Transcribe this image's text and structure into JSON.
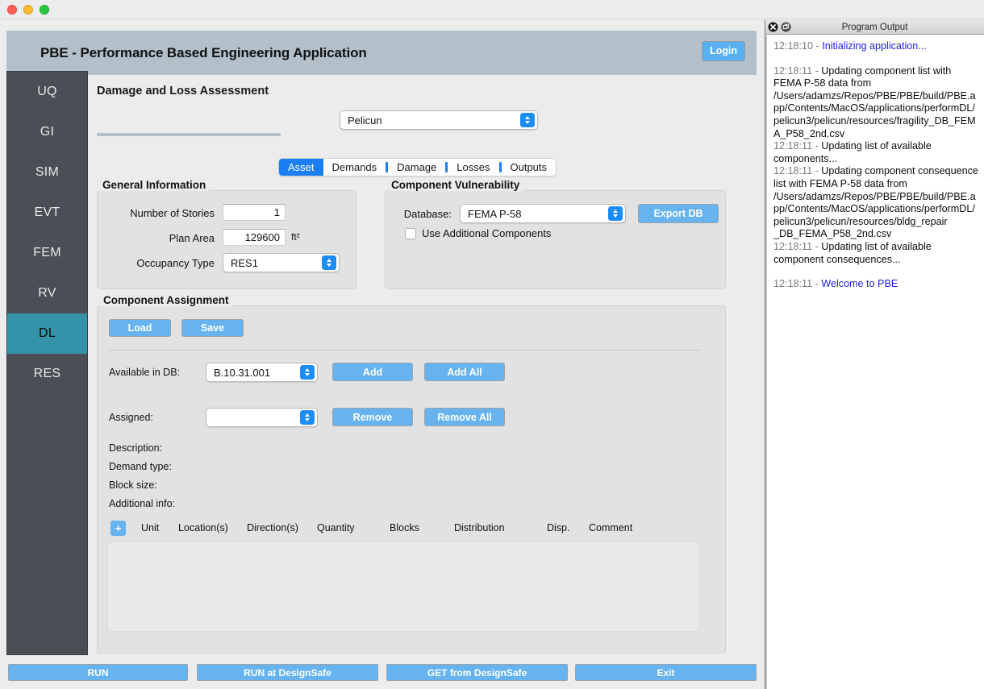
{
  "window": {
    "controls": [
      "close",
      "minimize",
      "maximize"
    ]
  },
  "header": {
    "title": "PBE - Performance Based Engineering Application",
    "login_label": "Login"
  },
  "sidebar": {
    "items": [
      {
        "label": "UQ",
        "active": false
      },
      {
        "label": "GI",
        "active": false
      },
      {
        "label": "SIM",
        "active": false
      },
      {
        "label": "EVT",
        "active": false
      },
      {
        "label": "FEM",
        "active": false
      },
      {
        "label": "RV",
        "active": false
      },
      {
        "label": "DL",
        "active": true
      },
      {
        "label": "RES",
        "active": false
      }
    ],
    "active_color": "#3493a9",
    "bg_color": "#4a4e55"
  },
  "page": {
    "section_title": "Damage and Loss Assessment",
    "engine_selected": "Pelicun"
  },
  "tabs": [
    {
      "label": "Asset",
      "selected": true
    },
    {
      "label": "Demands",
      "selected": false
    },
    {
      "label": "Damage",
      "selected": false
    },
    {
      "label": "Losses",
      "selected": false
    },
    {
      "label": "Outputs",
      "selected": false
    }
  ],
  "general_information": {
    "title": "General Information",
    "num_stories_label": "Number of Stories",
    "num_stories_value": "1",
    "plan_area_label": "Plan Area",
    "plan_area_value": "129600",
    "plan_area_unit": "ft²",
    "occupancy_label": "Occupancy Type",
    "occupancy_value": "RES1"
  },
  "component_vulnerability": {
    "title": "Component Vulnerability",
    "database_label": "Database:",
    "database_value": "FEMA P-58",
    "export_label": "Export DB",
    "use_additional_label": "Use Additional Components",
    "use_additional_checked": false
  },
  "component_assignment": {
    "title": "Component Assignment",
    "load_label": "Load",
    "save_label": "Save",
    "available_label": "Available in DB:",
    "available_value": "B.10.31.001",
    "add_label": "Add",
    "add_all_label": "Add All",
    "assigned_label": "Assigned:",
    "assigned_value": "",
    "remove_label": "Remove",
    "remove_all_label": "Remove All",
    "description_label": "Description:",
    "description_value": "",
    "demand_type_label": "Demand type:",
    "demand_type_value": "",
    "block_size_label": "Block size:",
    "block_size_value": "",
    "additional_info_label": "Additional info:",
    "additional_info_value": "",
    "add_row_label": "+",
    "table": {
      "columns": [
        "Unit",
        "Location(s)",
        "Direction(s)",
        "Quantity",
        "Blocks",
        "Distribution",
        "Disp.",
        "Comment"
      ],
      "rows": []
    }
  },
  "bottom_buttons": [
    {
      "label": "RUN"
    },
    {
      "label": "RUN at DesignSafe"
    },
    {
      "label": "GET from DesignSafe"
    },
    {
      "label": "Exit"
    }
  ],
  "program_output": {
    "title": "Program Output",
    "lines": [
      {
        "timestamp": "12:18:10",
        "message": "Initializing application...",
        "highlight": true,
        "blank_before": false
      },
      {
        "timestamp": "12:18:11",
        "message": "Updating component list with FEMA P-58 data from /Users/adamzs/Repos/PBE/PBE/build/PBE.app/Contents/MacOS/applications/performDL/pelicun3/pelicun/resources/fragility_DB_FEMA_P58_2nd.csv",
        "highlight": false,
        "blank_before": true
      },
      {
        "timestamp": "12:18:11",
        "message": "Updating list of available components...",
        "highlight": false,
        "blank_before": false
      },
      {
        "timestamp": "12:18:11",
        "message": "Updating component consequence list with FEMA P-58 data from /Users/adamzs/Repos/PBE/PBE/build/PBE.app/Contents/MacOS/applications/performDL/pelicun3/pelicun/resources/bldg_repair _DB_FEMA_P58_2nd.csv",
        "highlight": false,
        "blank_before": false
      },
      {
        "timestamp": "12:18:11",
        "message": "Updating list of available component consequences...",
        "highlight": false,
        "blank_before": false
      },
      {
        "timestamp": "12:18:11",
        "message": "Welcome to PBE",
        "highlight": true,
        "blank_before": true
      }
    ]
  },
  "colors": {
    "accent_blue": "#66b3f0",
    "tab_blue": "#1c7ef3",
    "header_band": "#b3c0c9",
    "nav_bg": "#4a4e55",
    "nav_active": "#3493a9",
    "log_link": "#2222dd"
  }
}
